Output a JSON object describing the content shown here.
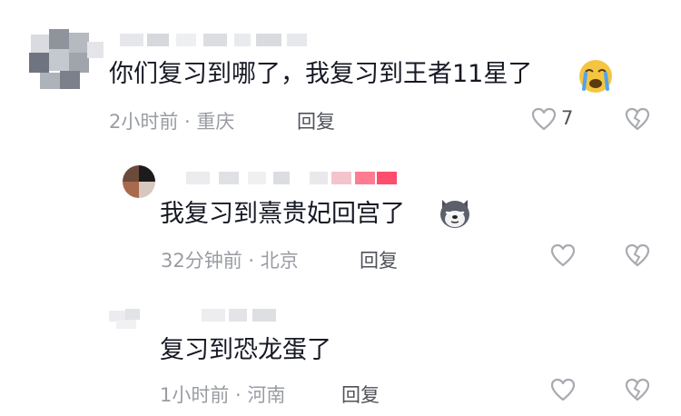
{
  "comments": [
    {
      "text": "你们复习到哪了，我复习到王者11星了",
      "emoji_icon": "crying-face-icon",
      "meta": "2小时前 · 重庆",
      "reply_label": "回复",
      "like_count": "7"
    },
    {
      "text": "我复习到熹贵妃回宫了",
      "emoji_icon": "husky-dog-face-icon",
      "meta": "32分钟前 · 北京",
      "reply_label": "回复"
    },
    {
      "text": "复习到恐龙蛋了",
      "meta": "1小时前 · 河南",
      "reply_label": "回复"
    }
  ],
  "colors": {
    "text": "#161823",
    "meta": "#9a9ca3",
    "icon": "#a8aab0",
    "highlight": "#ff4d6d"
  }
}
